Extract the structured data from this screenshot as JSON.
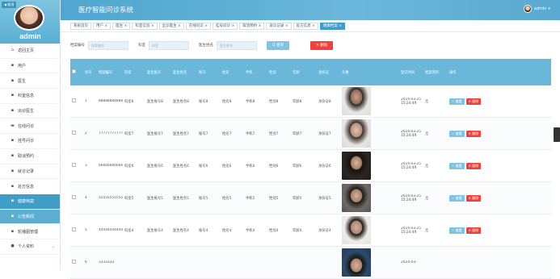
{
  "sidebar": {
    "back_label": "◀ 取消",
    "admin_name": "admin",
    "items": [
      {
        "label": "返回主页",
        "icon": "home-icon"
      },
      {
        "label": "用户",
        "icon": "grid-icon"
      },
      {
        "label": "医生",
        "icon": "grid-icon"
      },
      {
        "label": "科室信息",
        "icon": "grid-icon"
      },
      {
        "label": "出诊医生",
        "icon": "grid-icon"
      },
      {
        "label": "在线问诊",
        "icon": "monitor-icon"
      },
      {
        "label": "挂号问诊",
        "icon": "grid-icon"
      },
      {
        "label": "取消预约",
        "icon": "grid-icon"
      },
      {
        "label": "就诊记录",
        "icon": "grid-icon"
      },
      {
        "label": "处方信息",
        "icon": "grid-icon"
      },
      {
        "label": "健康档案",
        "icon": "grid-icon"
      },
      {
        "label": "公告新闻",
        "icon": "grid-icon"
      },
      {
        "label": "轮播图管理",
        "icon": "grid-icon"
      },
      {
        "label": "个人资料",
        "icon": "user-icon"
      }
    ]
  },
  "header": {
    "title": "医疗智能问诊系统",
    "user": "admin",
    "user_caret": "▾"
  },
  "tabs": [
    "系统首页",
    "用户 ×",
    "医生 ×",
    "科室信息 ×",
    "出诊医生 ×",
    "在线问诊 ×",
    "挂号问诊 ×",
    "取消预约 ×",
    "就诊记录 ×",
    "处方信息 ×",
    "健康档案 ×"
  ],
  "search": {
    "label1": "档案编号",
    "placeholder1": "档案编号",
    "label2": "科室",
    "placeholder2": "科室",
    "label3": "医生姓名",
    "placeholder3": "医生姓名",
    "search_btn": "Q 查询",
    "delete_btn": "✕ 删除"
  },
  "table": {
    "headers": [
      "序号",
      "档案编号",
      "科室",
      "医生账号",
      "医生姓名",
      "账号",
      "姓名",
      "手机",
      "性别",
      "年龄",
      "身份证",
      "头像",
      "登记时间",
      "档案资料",
      "操作"
    ],
    "view_btn": "✓ 查看",
    "del_btn": "✕ 删除",
    "rows": [
      {
        "no": "1",
        "code": "88888888888",
        "dept": "科室8",
        "doc_acc": "医生账号8",
        "doc_name": "医生姓名8",
        "acc": "账号8",
        "name": "姓名8",
        "phone": "手机8",
        "sex": "性别8",
        "age": "年龄8",
        "id": "身份证8",
        "time": "2024-03-25 15:24:49",
        "doc": "无"
      },
      {
        "no": "2",
        "code": "77777777777",
        "dept": "科室7",
        "doc_acc": "医生账号7",
        "doc_name": "医生姓名7",
        "acc": "账号7",
        "name": "姓名7",
        "phone": "手机7",
        "sex": "性别7",
        "age": "年龄7",
        "id": "身份证7",
        "time": "2024-03-25 15:24:49",
        "doc": "无"
      },
      {
        "no": "3",
        "code": "66666666666",
        "dept": "科室6",
        "doc_acc": "医生账号6",
        "doc_name": "医生姓名6",
        "acc": "账号6",
        "name": "姓名6",
        "phone": "手机6",
        "sex": "性别6",
        "age": "年龄6",
        "id": "身份证6",
        "time": "2024-03-25 15:24:49",
        "doc": "无"
      },
      {
        "no": "4",
        "code": "55555555555",
        "dept": "科室5",
        "doc_acc": "医生账号5",
        "doc_name": "医生姓名5",
        "acc": "账号5",
        "name": "姓名5",
        "phone": "手机5",
        "sex": "性别5",
        "age": "年龄5",
        "id": "身份证5",
        "time": "2024-03-25 15:24:49",
        "doc": "无"
      },
      {
        "no": "5",
        "code": "44444444444",
        "dept": "科室4",
        "doc_acc": "医生账号4",
        "doc_name": "医生姓名4",
        "acc": "账号4",
        "name": "姓名4",
        "phone": "手机4",
        "sex": "性别4",
        "age": "年龄4",
        "id": "身份证4",
        "time": "2024-03-25 15:24:49",
        "doc": "无"
      },
      {
        "no": "6",
        "code": "3333333",
        "dept": "",
        "doc_acc": "",
        "doc_name": "",
        "acc": "",
        "name": "",
        "phone": "",
        "sex": "",
        "age": "",
        "id": "",
        "time": "2024-03-",
        "doc": ""
      }
    ]
  }
}
